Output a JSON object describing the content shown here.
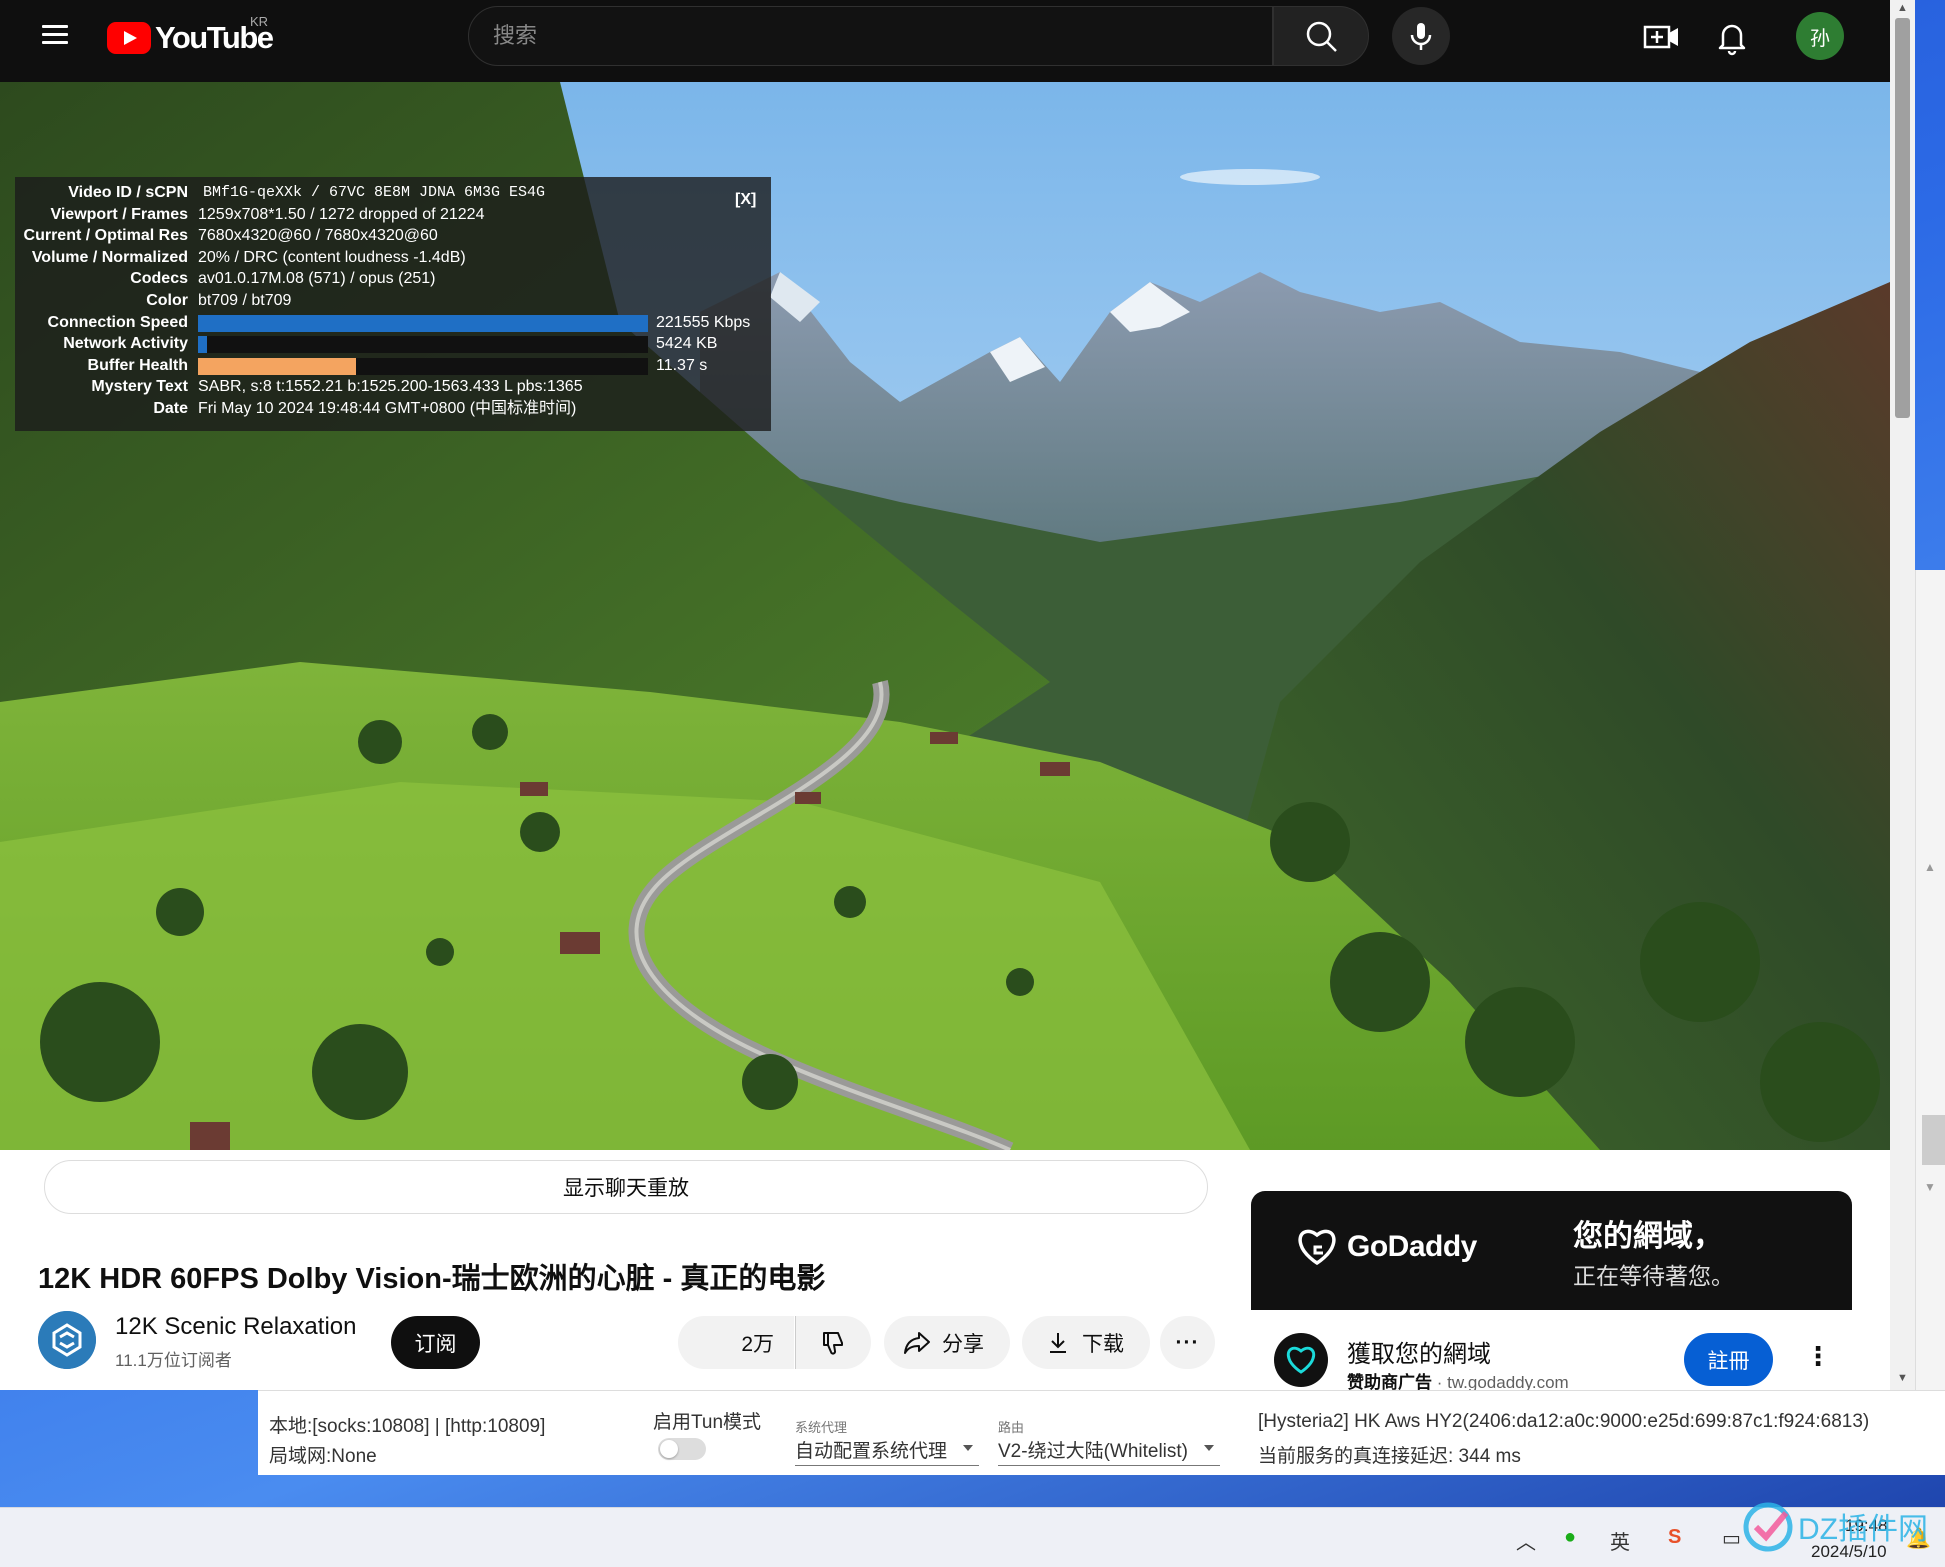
{
  "youtube": {
    "logo_text": "YouTube",
    "country_code": "KR",
    "search_placeholder": "搜索",
    "user_avatar_initial": "孙",
    "brand_red": "#ff0000",
    "accent_blue": "#065fd4"
  },
  "stats_for_nerds": {
    "close_label": "[X]",
    "rows": [
      {
        "key": "Video ID / sCPN",
        "value": "BMf1G-qeXXk / 67VC 8E8M JDNA 6M3G ES4G"
      },
      {
        "key": "Viewport / Frames",
        "value": "1259x708*1.50 / 1272 dropped of 21224"
      },
      {
        "key": "Current / Optimal Res",
        "value": "7680x4320@60 / 7680x4320@60"
      },
      {
        "key": "Volume / Normalized",
        "value": "20% / DRC (content loudness -1.4dB)"
      },
      {
        "key": "Codecs",
        "value": "av01.0.17M.08 (571) / opus (251)"
      },
      {
        "key": "Color",
        "value": "bt709 / bt709"
      }
    ],
    "bars": [
      {
        "key": "Connection Speed",
        "value": "221555 Kbps",
        "color": "#1f6fc5",
        "fill": 1.0
      },
      {
        "key": "Network Activity",
        "value": "5424 KB",
        "color": "#1f6fc5",
        "fill": 0.02
      },
      {
        "key": "Buffer Health",
        "value": "11.37 s",
        "color": "#f4a460",
        "fill": 0.35
      }
    ],
    "rows_after": [
      {
        "key": "Mystery Text",
        "value": "SABR, s:8 t:1552.21 b:1525.200-1563.433 L pbs:1365"
      },
      {
        "key": "Date",
        "value": "Fri May 10 2024 19:48:44 GMT+0800 (中国标准时间)"
      }
    ]
  },
  "below_player": {
    "chat_replay_label": "显示聊天重放",
    "title": "12K HDR 60FPS Dolby Vision-瑞士欧洲的心脏 - 真正的电影",
    "channel_name": "12K Scenic Relaxation",
    "subscribers": "11.1万位订阅者",
    "subscribe_label": "订阅",
    "likes": "2万",
    "share_label": "分享",
    "download_label": "下载",
    "more_label": "···"
  },
  "ad": {
    "brand": "GoDaddy",
    "headline_line1": "您的網域，",
    "headline_line2": "正在等待著您。",
    "title": "獲取您的網域",
    "sponsor_label": "赞助商广告",
    "separator": " · ",
    "domain": "tw.godaddy.com",
    "cta_label": "註冊",
    "more_label": "⋮"
  },
  "proxy_client": {
    "local_ports": "本地:[socks:10808] | [http:10809]",
    "lan": "局域网:None",
    "tun_label": "启用Tun模式",
    "tun_enabled": false,
    "system_proxy_caption": "系统代理",
    "system_proxy_value": "自动配置系统代理",
    "routing_caption": "路由",
    "routing_value": "V2-绕过大陆(Whitelist)",
    "server": "[Hysteria2] HK Aws HY2(2406:da12:a0c:9000:e25d:699:87c1:f924:6813)",
    "latency": "当前服务的真连接延迟: 344 ms"
  },
  "taskbar": {
    "ime_label": "英",
    "time": "19:48",
    "date": "2024/5/10"
  },
  "watermark": {
    "text": "DZ插件网"
  }
}
